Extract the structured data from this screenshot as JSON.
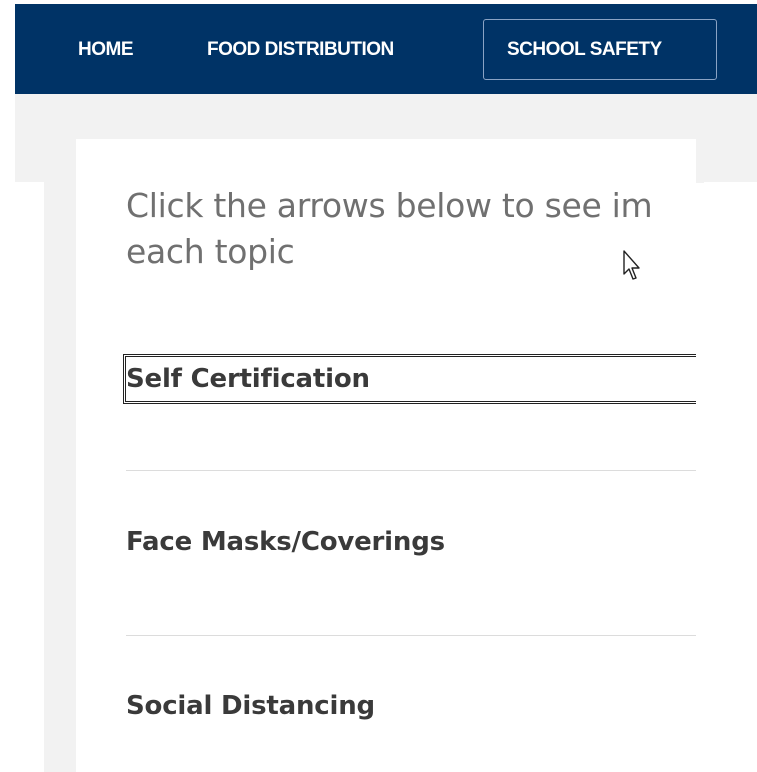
{
  "nav": {
    "items": [
      {
        "label": "HOME"
      },
      {
        "label": "FOOD DISTRIBUTION"
      },
      {
        "label": "SCHOOL SAFETY"
      }
    ],
    "active_index": 2
  },
  "content": {
    "intro_line1": "Click the arrows below to see im",
    "intro_line2": "each topic",
    "topics": [
      {
        "label": "Self Certification"
      },
      {
        "label": "Face Masks/Coverings"
      },
      {
        "label": "Social Distancing"
      }
    ]
  },
  "colors": {
    "nav_bg": "#003366",
    "nav_text": "#ffffff",
    "page_grey": "#f2f2f2",
    "intro_text": "#707070",
    "topic_text": "#3a3a3a",
    "divider": "#dcdcdc"
  },
  "icons": {
    "cursor": "mouse-pointer-icon"
  }
}
